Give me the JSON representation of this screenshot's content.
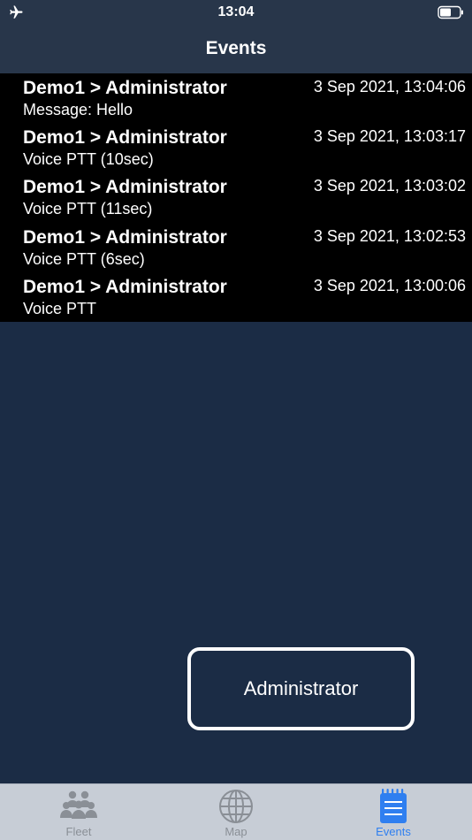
{
  "status_bar": {
    "time": "13:04",
    "icons": [
      "airplane-icon",
      "battery-icon"
    ]
  },
  "nav": {
    "title": "Events"
  },
  "events": [
    {
      "title": "Demo1 > Administrator",
      "time": "3 Sep 2021, 13:04:06",
      "detail": "Message: Hello"
    },
    {
      "title": "Demo1 > Administrator",
      "time": "3 Sep 2021, 13:03:17",
      "detail": "Voice PTT (10sec)"
    },
    {
      "title": "Demo1 > Administrator",
      "time": "3 Sep 2021, 13:03:02",
      "detail": "Voice PTT (11sec)"
    },
    {
      "title": "Demo1 > Administrator",
      "time": "3 Sep 2021, 13:02:53",
      "detail": "Voice PTT (6sec)"
    },
    {
      "title": "Demo1 > Administrator",
      "time": "3 Sep 2021, 13:00:06",
      "detail": "Voice PTT"
    }
  ],
  "overlay": {
    "label": "Administrator"
  },
  "tabs": [
    {
      "label": "Fleet",
      "icon": "fleet-icon",
      "active": false
    },
    {
      "label": "Map",
      "icon": "globe-icon",
      "active": false
    },
    {
      "label": "Events",
      "icon": "events-list-icon",
      "active": true
    }
  ],
  "colors": {
    "background": "#1b2c45",
    "header": "#28364a",
    "list": "#000000",
    "tab_bar": "#c7cdd6",
    "tab_active": "#2f7ff0",
    "tab_inactive": "#8a8f96"
  }
}
